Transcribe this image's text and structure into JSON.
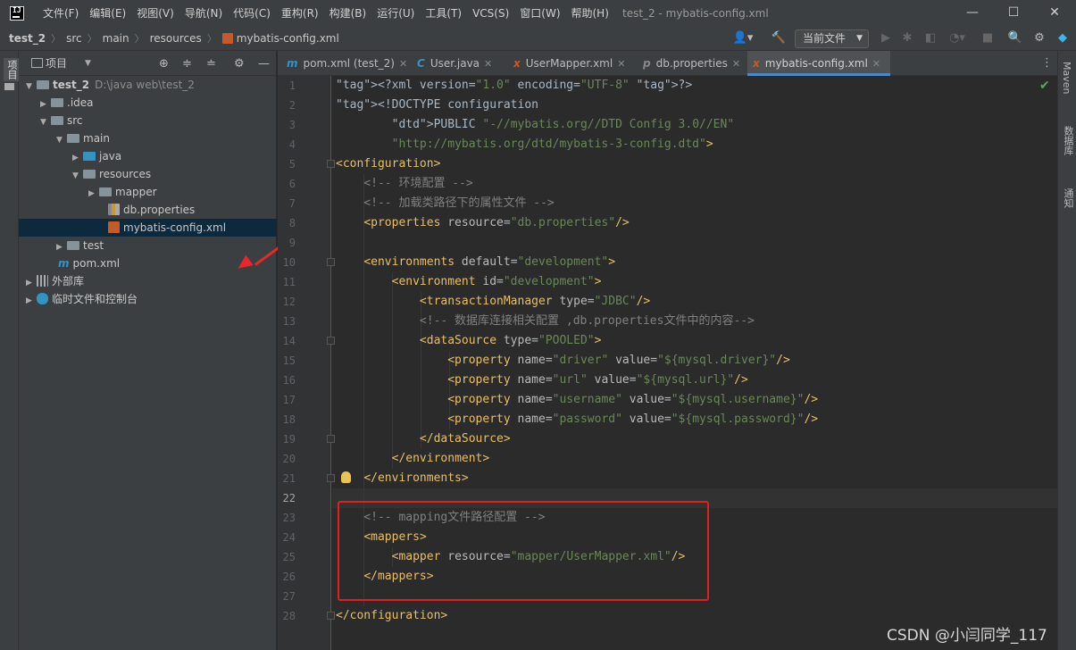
{
  "menu": [
    "文件(F)",
    "编辑(E)",
    "视图(V)",
    "导航(N)",
    "代码(C)",
    "重构(R)",
    "构建(B)",
    "运行(U)",
    "工具(T)",
    "VCS(S)",
    "窗口(W)",
    "帮助(H)"
  ],
  "window_title": "test_2 - mybatis-config.xml",
  "breadcrumbs": [
    "test_2",
    "src",
    "main",
    "resources",
    "mybatis-config.xml"
  ],
  "run_config": "当前文件",
  "project_panel": {
    "title": "项目"
  },
  "left_strip_label": "项目",
  "tree": [
    {
      "label": "test_2",
      "extra": "D:\\java web\\test_2",
      "bold": true
    },
    {
      "label": ".idea"
    },
    {
      "label": "src"
    },
    {
      "label": "main"
    },
    {
      "label": "java"
    },
    {
      "label": "resources"
    },
    {
      "label": "mapper"
    },
    {
      "label": "db.properties"
    },
    {
      "label": "mybatis-config.xml"
    },
    {
      "label": "test"
    },
    {
      "label": "pom.xml"
    },
    {
      "label": "外部库"
    },
    {
      "label": "临时文件和控制台"
    }
  ],
  "tabs": [
    {
      "label": "pom.xml (test_2)"
    },
    {
      "label": "User.java"
    },
    {
      "label": "UserMapper.xml"
    },
    {
      "label": "db.properties"
    },
    {
      "label": "mybatis-config.xml",
      "active": true
    }
  ],
  "right_tools": [
    "Maven",
    "数据库",
    "通知"
  ],
  "code_lines": [
    "<?xml version=\"1.0\" encoding=\"UTF-8\" ?>",
    "<!DOCTYPE configuration",
    "        PUBLIC \"-//mybatis.org//DTD Config 3.0//EN\"",
    "        \"http://mybatis.org/dtd/mybatis-3-config.dtd\">",
    "<configuration>",
    "    <!-- 环境配置 -->",
    "    <!-- 加载类路径下的属性文件 -->",
    "    <properties resource=\"db.properties\"/>",
    "",
    "    <environments default=\"development\">",
    "        <environment id=\"development\">",
    "            <transactionManager type=\"JDBC\"/>",
    "            <!-- 数据库连接相关配置 ,db.properties文件中的内容-->",
    "            <dataSource type=\"POOLED\">",
    "                <property name=\"driver\" value=\"${mysql.driver}\"/>",
    "                <property name=\"url\" value=\"${mysql.url}\"/>",
    "                <property name=\"username\" value=\"${mysql.username}\"/>",
    "                <property name=\"password\" value=\"${mysql.password}\"/>",
    "            </dataSource>",
    "        </environment>",
    "    </environments>",
    "",
    "    <!-- mapping文件路径配置 -->",
    "    <mappers>",
    "        <mapper resource=\"mapper/UserMapper.xml\"/>",
    "    </mappers>",
    "",
    "</configuration>"
  ],
  "current_line": 22,
  "watermark": "CSDN @小闫同学_117",
  "colors": {
    "accent": "#4a88c7",
    "highlight_box": "#e31e1e",
    "selection": "#0d293e"
  }
}
